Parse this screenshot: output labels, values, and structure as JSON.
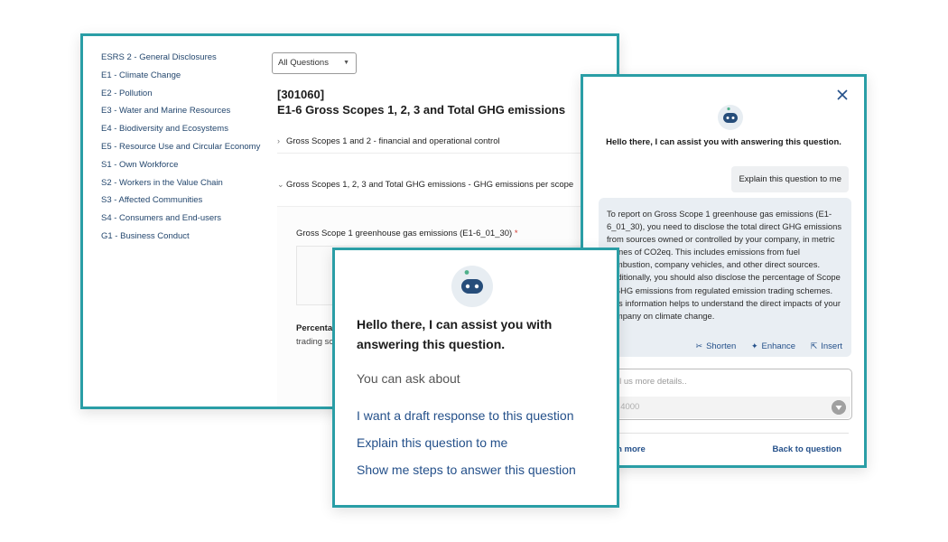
{
  "sidebar": {
    "items": [
      {
        "label": "ESRS 2 - General Disclosures"
      },
      {
        "label": "E1 - Climate Change"
      },
      {
        "label": "E2 - Pollution"
      },
      {
        "label": "E3 - Water and Marine Resources"
      },
      {
        "label": "E4 - Biodiversity and Ecosystems"
      },
      {
        "label": "E5 - Resource Use and Circular Economy"
      },
      {
        "label": "S1 - Own Workforce"
      },
      {
        "label": "S2 - Workers in the Value Chain"
      },
      {
        "label": "S3 - Affected Communities"
      },
      {
        "label": "S4 - Consumers and End-users"
      },
      {
        "label": "G1 - Business Conduct"
      }
    ]
  },
  "filter": {
    "selected": "All Questions"
  },
  "question": {
    "code": "[301060]",
    "title": "E1-6 Gross Scopes 1, 2, 3 and Total GHG emissions",
    "sections": [
      {
        "label": "Gross Scopes 1 and 2 - financial and operational control",
        "state": "collapsed"
      },
      {
        "label": "Gross Scopes 1, 2, 3 and Total GHG emissions - GHG emissions per scope",
        "state": "expanded"
      }
    ],
    "field_label": "Gross Scope 1 greenhouse gas emissions (E1-6_01_30)",
    "required_marker": "*",
    "pct_label_fragment": "Percentag",
    "pct_sub_fragment": "trading sc"
  },
  "chat": {
    "greeting": "Hello there, I can assist you with answering this question.",
    "user_message": "Explain this question to me",
    "answer": "To report on Gross Scope 1 greenhouse gas emissions (E1- 6_01_30), you need to disclose the total direct GHG emissions from sources owned or controlled by your company, in metric tonnes of CO2eq. This includes emissions from fuel combustion, company vehicles, and other direct sources. Additionally, you should also disclose the percentage of Scope 1 GHG emissions from regulated emission trading schemes. This information helps to understand the direct impacts of your company on climate change.",
    "actions": {
      "shorten": "Shorten",
      "enhance": "Enhance",
      "insert": "Insert"
    },
    "input_placeholder": "Tell us more details..",
    "char_counter": "0 / 4000",
    "learn_more": "Learn more",
    "back": "Back to question"
  },
  "front": {
    "greeting": "Hello there, I can assist you with answering this question.",
    "ask_about": "You can ask about",
    "suggestions": [
      "I want a draft response to this question",
      "Explain this question to me",
      "Show me steps to answer this question"
    ]
  },
  "colors": {
    "accent": "#2a9ea6",
    "link": "#24508a",
    "sidebar_text": "#24476e",
    "bot_face": "#264d7a"
  }
}
